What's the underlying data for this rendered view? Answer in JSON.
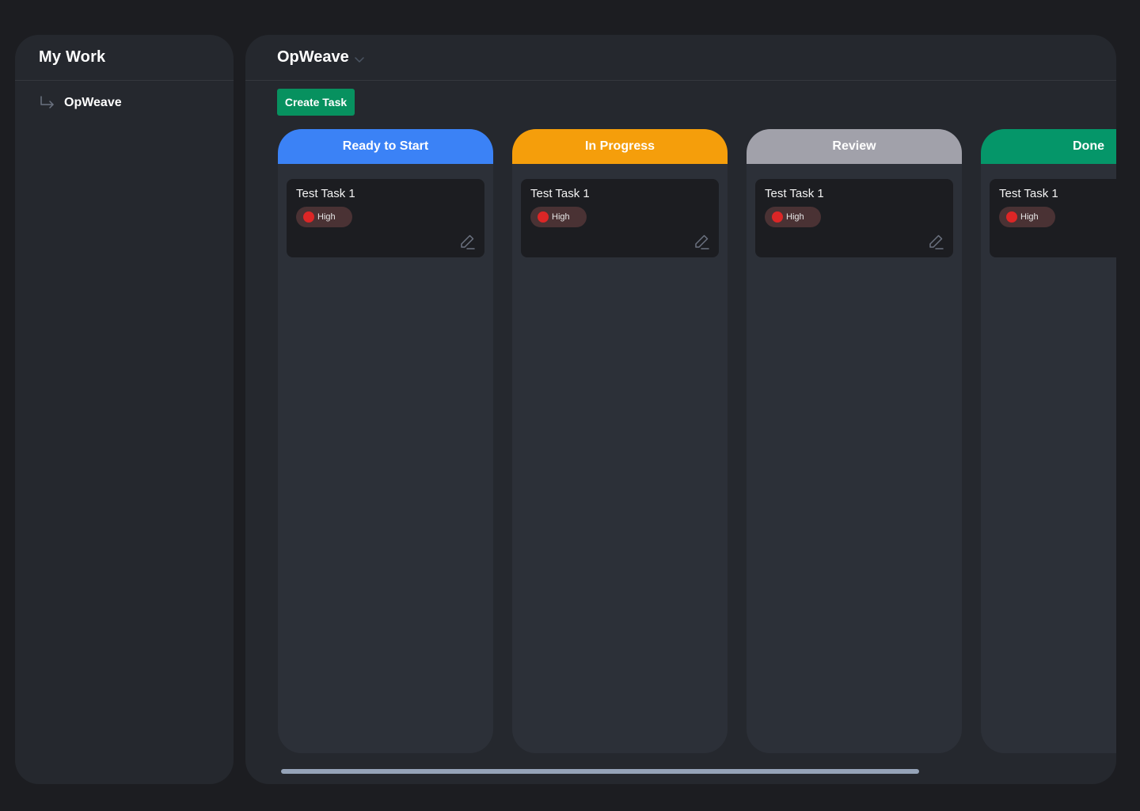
{
  "sidebar": {
    "title": "My Work",
    "items": [
      {
        "label": "OpWeave",
        "icon": "arrow-turn-down-right-icon"
      }
    ]
  },
  "header": {
    "project_name": "OpWeave",
    "dropdown_icon": "chevron-down-icon"
  },
  "toolbar": {
    "create_label": "Create Task"
  },
  "columns": [
    {
      "title": "Ready to Start",
      "color": "#3b82f6",
      "cards": [
        {
          "title": "Test Task 1",
          "priority": "High",
          "priority_color": "#dc2626"
        }
      ]
    },
    {
      "title": "In Progress",
      "color": "#f59e0b",
      "cards": [
        {
          "title": "Test Task 1",
          "priority": "High",
          "priority_color": "#dc2626"
        }
      ]
    },
    {
      "title": "Review",
      "color": "#a1a1aa",
      "cards": [
        {
          "title": "Test Task 1",
          "priority": "High",
          "priority_color": "#dc2626"
        }
      ]
    },
    {
      "title": "Done",
      "color": "#059669",
      "cards": [
        {
          "title": "Test Task 1",
          "priority": "High",
          "priority_color": "#dc2626"
        }
      ]
    }
  ],
  "colors": {
    "background": "#1c1d21",
    "panel": "#25282e",
    "column_body": "#2c3038",
    "accent_green": "#07915f"
  }
}
